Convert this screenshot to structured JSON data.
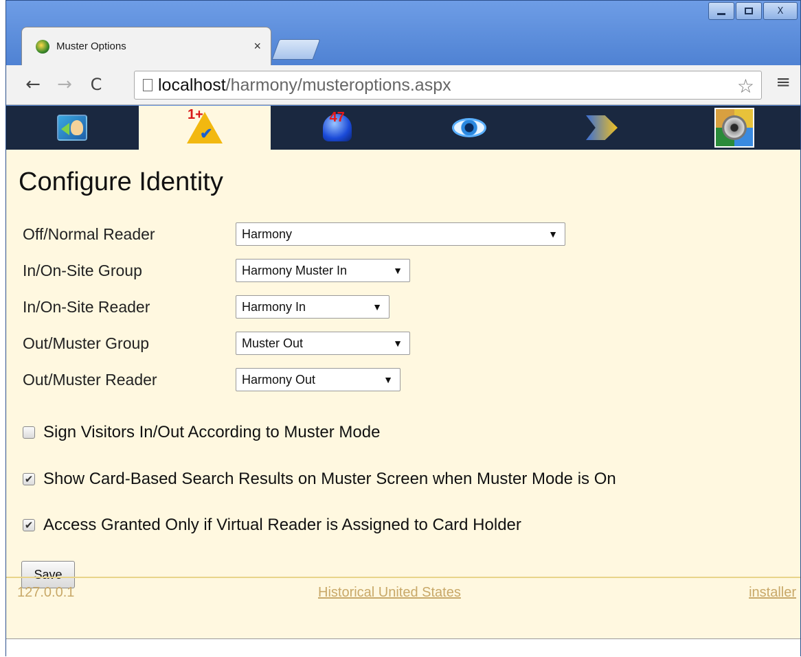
{
  "browser": {
    "tab_title": "Muster Options",
    "tab_close": "×",
    "url_host": "localhost",
    "url_path": "/harmony/musteroptions.aspx",
    "back": "←",
    "forward": "→",
    "reload": "C",
    "star": "☆",
    "menu": "≡",
    "window_close": "X"
  },
  "appnav": {
    "items": [
      {
        "icon": "profile-icon"
      },
      {
        "icon": "muster-icon",
        "badge": "1+",
        "active": true
      },
      {
        "icon": "alarm-icon",
        "badge": "47"
      },
      {
        "icon": "eye-icon"
      },
      {
        "icon": "forward-icon"
      },
      {
        "icon": "settings-icon"
      }
    ]
  },
  "main": {
    "title": "Configure Identity",
    "fields": [
      {
        "label": "Off/Normal Reader",
        "value": "Harmony"
      },
      {
        "label": "In/On-Site Group",
        "value": "Harmony Muster In"
      },
      {
        "label": "In/On-Site Reader",
        "value": "Harmony In"
      },
      {
        "label": "Out/Muster Group",
        "value": "Muster Out"
      },
      {
        "label": "Out/Muster Reader",
        "value": "Harmony Out"
      }
    ],
    "arrow": "▼",
    "checkboxes": [
      {
        "label": "Sign Visitors In/Out According to Muster Mode",
        "checked": false
      },
      {
        "label": "Show Card-Based Search Results on Muster Screen when Muster Mode is On",
        "checked": true
      },
      {
        "label": "Access Granted Only if Virtual Reader is Assigned to Card Holder",
        "checked": true
      }
    ],
    "check_mark": "✔",
    "save_label": "Save"
  },
  "footer": {
    "ip": "127.0.0.1",
    "center_link": "Historical United States",
    "right_link": "installer"
  }
}
